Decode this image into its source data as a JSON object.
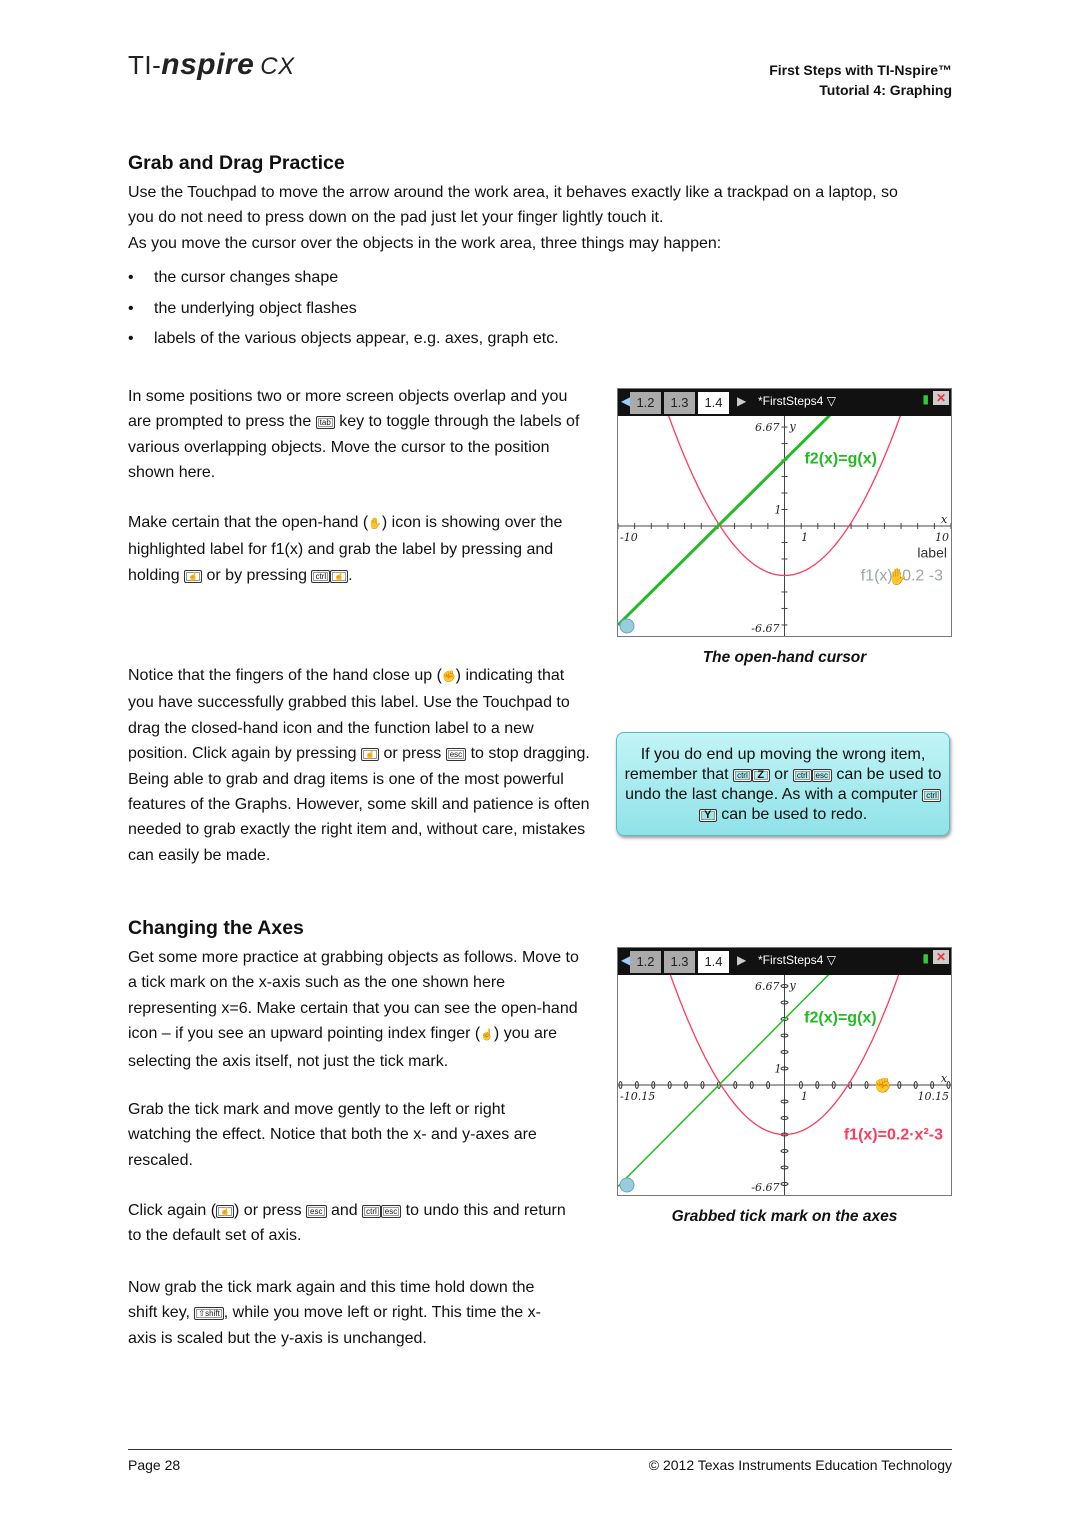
{
  "header": {
    "logo": {
      "ti": "TI-",
      "nspire": "nspire",
      "cx": "CX"
    },
    "line1": "First Steps with TI-Nspire™",
    "line2": "Tutorial 4: Graphing"
  },
  "grab": {
    "title": "Grab and Drag Practice",
    "intro": [
      "Use the Touchpad to move the arrow around the work area, it behaves exactly like a trackpad on a laptop, so",
      "you do not need to press down on the pad just let your finger lightly touch it.",
      "As you move the cursor over the objects in the work area, three things may happen:"
    ],
    "bullets": [
      "the cursor changes shape",
      "the underlying object flashes",
      "labels of the various objects appear, e.g. axes, graph etc."
    ],
    "p1": {
      "a": "In some positions two or more screen objects overlap and you are prompted to press the ",
      "key": "tab",
      "b": " key to toggle through the labels of various overlapping objects. Move the cursor to the position shown here."
    },
    "p2": {
      "a": "Make certain that the open-hand (",
      "b": ") icon is showing over the highlighted label for f1(x) and grab the label by pressing and holding ",
      "c": " or by pressing ",
      "ctrl": "ctrl",
      "d": "."
    },
    "p3": {
      "a": "Notice that the fingers of the hand close up (",
      "b": ") indicating that you have successfully grabbed this label. Use the Touchpad to drag the closed-hand icon and the function label to a new position. Click again by pressing ",
      "c": " or press ",
      "esc": "esc",
      "d": " to stop dragging. Being able to grab and drag items is one of the most powerful features of the Graphs. However, some skill and patience is often needed to grab exactly the right item and, without care, mistakes can easily be made."
    },
    "caption": "The open-hand cursor"
  },
  "tip": {
    "a": "If you do end up moving the wrong item, remember that ",
    "k1": "ctrl",
    "k2": "Z",
    "b": " or ",
    "k3": "ctrl",
    "k4": "esc",
    "c": " can be used to undo the last change. As with a computer ",
    "k5": "ctrl",
    "k6": "Y",
    "d": " can be used to redo."
  },
  "axes": {
    "title": "Changing the Axes",
    "p1": {
      "a": "Get some more practice at grabbing objects as follows. Move to a tick mark on the x-axis such as the one shown here representing x=6. Make certain that you can see the open-hand icon – if you see an upward pointing index finger (",
      "b": ") you are selecting the axis itself, not just the tick mark."
    },
    "p2": "Grab the tick mark and move gently to the left or right watching the effect. Notice that both the x- and y-axes are rescaled.",
    "p3": {
      "a": "Click again (",
      "b": ") or press ",
      "esc": "esc",
      "c": " and ",
      "ctrl": "ctrl",
      "esc2": "esc",
      "d": " to undo this and return to the default set of axis."
    },
    "p4": {
      "a": "Now grab the tick mark again and this time hold down the shift key, ",
      "shift": "⇧shift",
      "b": ", while you move left or right. This time the x-axis is scaled but the y-axis is unchanged."
    },
    "caption": "Grabbed tick mark on the axes"
  },
  "screens": [
    {
      "tabs": [
        "1.2",
        "1.3",
        "1.4"
      ],
      "active_tab": "1.4",
      "doc_title": "*FirstSteps4",
      "xmin": -10,
      "xmax": 10,
      "ymin": -6.67,
      "ymax": 6.67,
      "labels": {
        "ymax": "6.67",
        "ymin": "-6.67",
        "xmin": "-10",
        "xmax": "10",
        "one_x": "1",
        "one_y": "1",
        "x": "x",
        "y": "y"
      },
      "f2_label": "f2(x)=g(x)",
      "f1_label": "f1(x)=0.2",
      "f1_tail": "-3",
      "extra_label": "label",
      "f1_color": "#ff3b5c",
      "f2_color": "#22bb22",
      "f1_label_color": "#9aa4a8",
      "f2_width": 3,
      "state": "open-hand over f1 label"
    },
    {
      "tabs": [
        "1.2",
        "1.3",
        "1.4"
      ],
      "active_tab": "1.4",
      "doc_title": "*FirstSteps4",
      "xmin": -10.15,
      "xmax": 10.15,
      "ymin": -6.67,
      "ymax": 6.67,
      "labels": {
        "ymax": "6.67",
        "ymin": "-6.67",
        "xmin": "-10.15",
        "xmax": "10.15",
        "one_x": "1",
        "one_y": "1",
        "x": "x",
        "y": "y"
      },
      "f2_label": "f2(x)=g(x)",
      "f1_label": "f1(x)=0.2·x²-3",
      "f1_color": "#ff3b5c",
      "f2_color": "#22bb22",
      "f1_label_color": "#ff3b5c",
      "f2_width": 1.5,
      "state": "tick mark grabbed at x=6"
    }
  ],
  "footer": {
    "page": "Page  28",
    "copyright": "© 2012 Texas Instruments Education Technology"
  }
}
